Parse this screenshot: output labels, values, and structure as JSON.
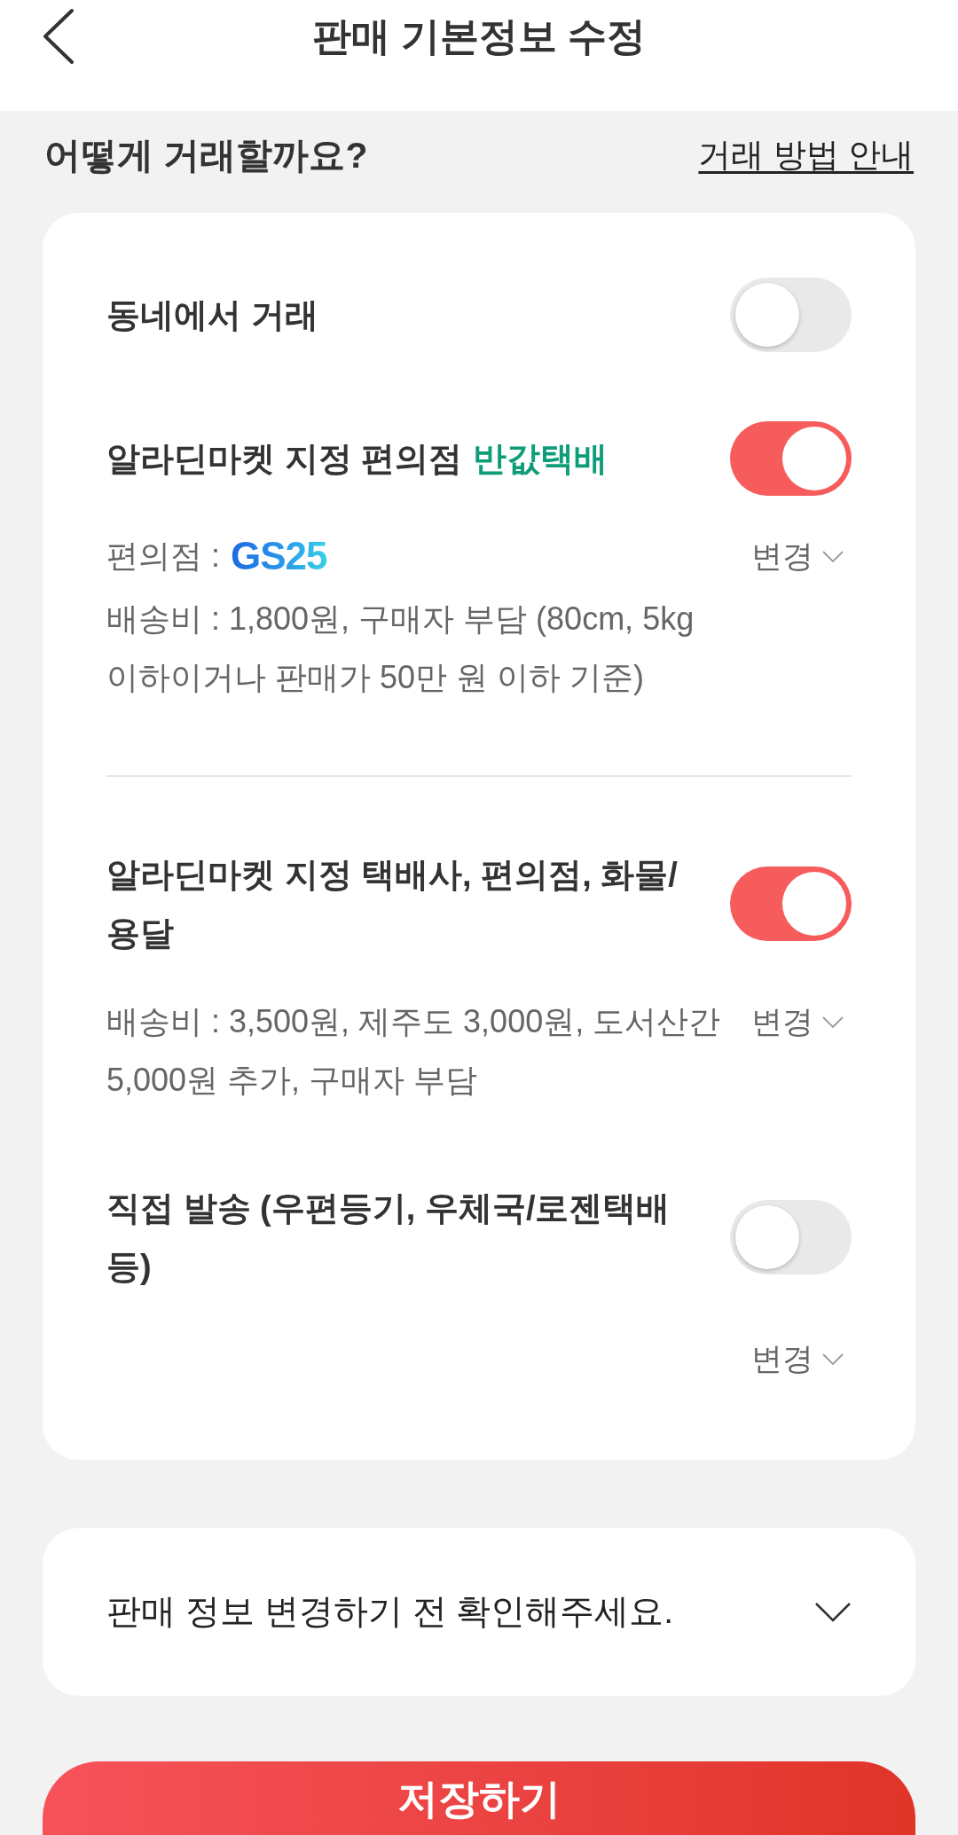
{
  "header": {
    "title": "판매 기본정보 수정"
  },
  "section": {
    "heading": "어떻게 거래할까요?",
    "guide_link": "거래 방법 안내"
  },
  "option_groups": [
    {
      "options": [
        {
          "kind": "toggle_only",
          "title": "동네에서 거래",
          "on": false
        },
        {
          "kind": "store",
          "title": "알라딘마켓 지정 편의점",
          "highlight": "반값택배",
          "on": true,
          "store_label": "편의점 :",
          "store_logo": "GS25",
          "change": "변경",
          "fee": "배송비 : 1,800원, 구매자 부담 (80cm, 5kg 이하이거나 판매가 50만 원 이하 기준)"
        }
      ]
    },
    {
      "options": [
        {
          "kind": "fee_beside",
          "title": "알라딘마켓 지정 택배사, 편의점, 화물/용달",
          "on": true,
          "fee": "배송비 : 3,500원, 제주도 3,000원, 도서산간 5,000원 추가, 구매자 부담",
          "change": "변경"
        },
        {
          "kind": "change_below",
          "title": "직접 발송 (우편등기, 우체국/로젠택배 등)",
          "on": false,
          "change": "변경"
        }
      ]
    }
  ],
  "notice": {
    "text": "판매 정보 변경하기 전 확인해주세요.",
    "expanded": false
  },
  "save_button": "저장하기"
}
